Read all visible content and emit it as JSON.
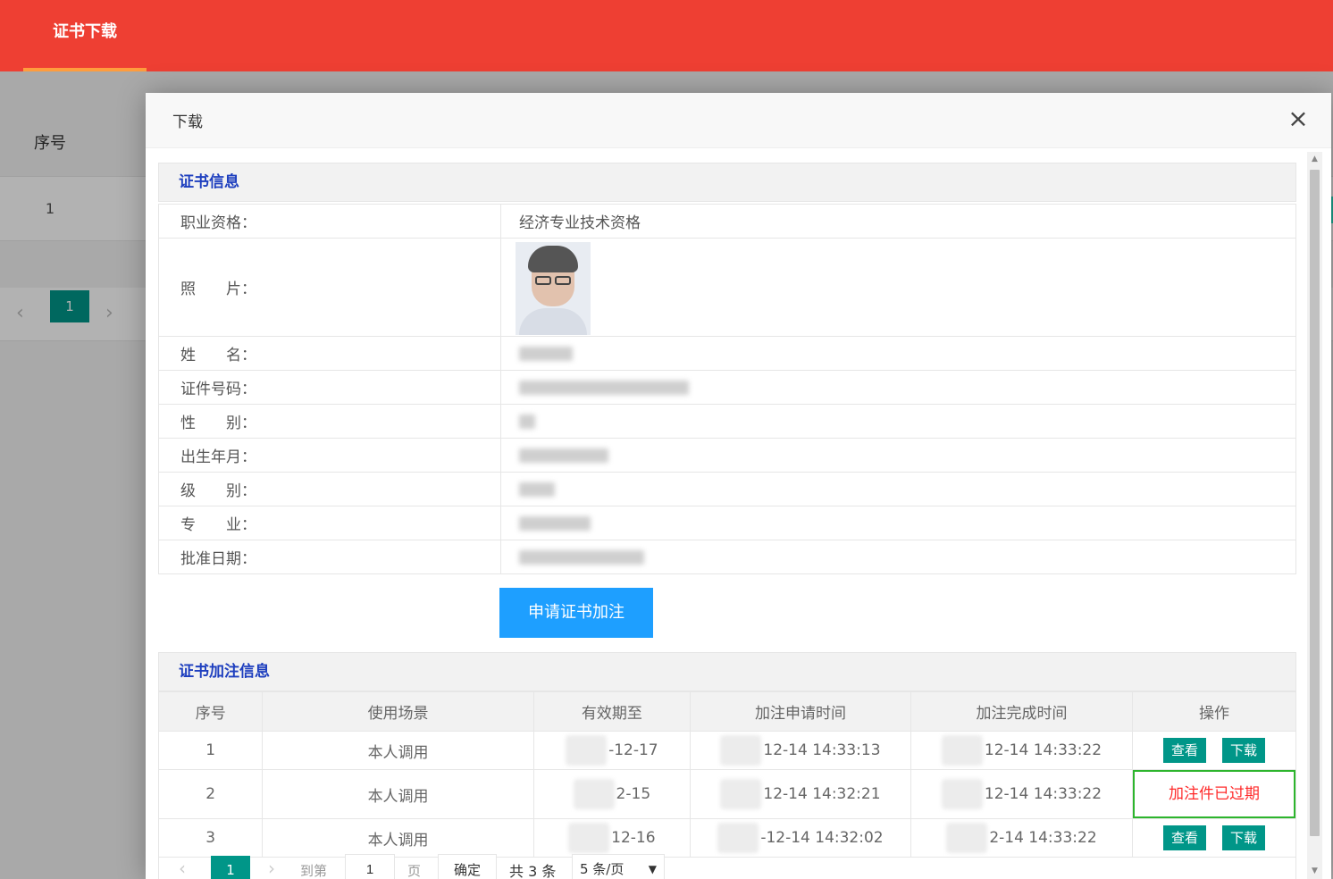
{
  "topbar": {
    "tab_label": "证书下载"
  },
  "background": {
    "table_header": "序号",
    "row_index": "1",
    "pager": {
      "prev": "‹",
      "current": "1",
      "next": "›"
    }
  },
  "modal": {
    "title": "下载",
    "close_icon": "×",
    "cert_section_title": "证书信息",
    "fields": [
      {
        "label": "职业资格：",
        "value": "经济专业技术资格"
      },
      {
        "label": "照　　片："
      },
      {
        "label": "姓　　名："
      },
      {
        "label": "证件号码："
      },
      {
        "label": "性　　别："
      },
      {
        "label": "出生年月："
      },
      {
        "label": "级　　别："
      },
      {
        "label": "专　　业："
      },
      {
        "label": "批准日期："
      }
    ],
    "apply_button": "申请证书加注",
    "annot_section_title": "证书加注信息",
    "annot_table": {
      "headers": [
        "序号",
        "使用场景",
        "有效期至",
        "加注申请时间",
        "加注完成时间",
        "操作"
      ],
      "rows": [
        {
          "index": "1",
          "scene": "本人调用",
          "valid_to": "-12-17",
          "applied": "12-14 14:33:13",
          "completed": "12-14 14:33:22",
          "status": "actions"
        },
        {
          "index": "2",
          "scene": "本人调用",
          "valid_to": "2-15",
          "applied": "12-14 14:32:21",
          "completed": "12-14 14:33:22",
          "status": "expired"
        },
        {
          "index": "3",
          "scene": "本人调用",
          "valid_to": "12-16",
          "applied": "-12-14 14:32:02",
          "completed": "2-14 14:33:22",
          "status": "actions"
        }
      ],
      "view_label": "查看",
      "download_label": "下载",
      "expired_label": "加注件已过期"
    },
    "pager": {
      "prev": "‹",
      "current": "1",
      "next": "›",
      "goto_label": "到第",
      "goto_value": "1",
      "page_unit": "页",
      "confirm": "确定",
      "total": "共 3 条",
      "page_size": "5 条/页"
    }
  },
  "colors": {
    "topbar": "#ee3f33",
    "primary_green": "#009688",
    "apply_blue": "#1e9fff",
    "section_title_blue": "#1e3fbf",
    "expired_red": "#ff2a2a",
    "highlight_green": "#2db52d"
  },
  "icons": {
    "close": "close-icon",
    "prev": "chevron-left-icon",
    "next": "chevron-right-icon",
    "select": "chevron-down-icon"
  }
}
